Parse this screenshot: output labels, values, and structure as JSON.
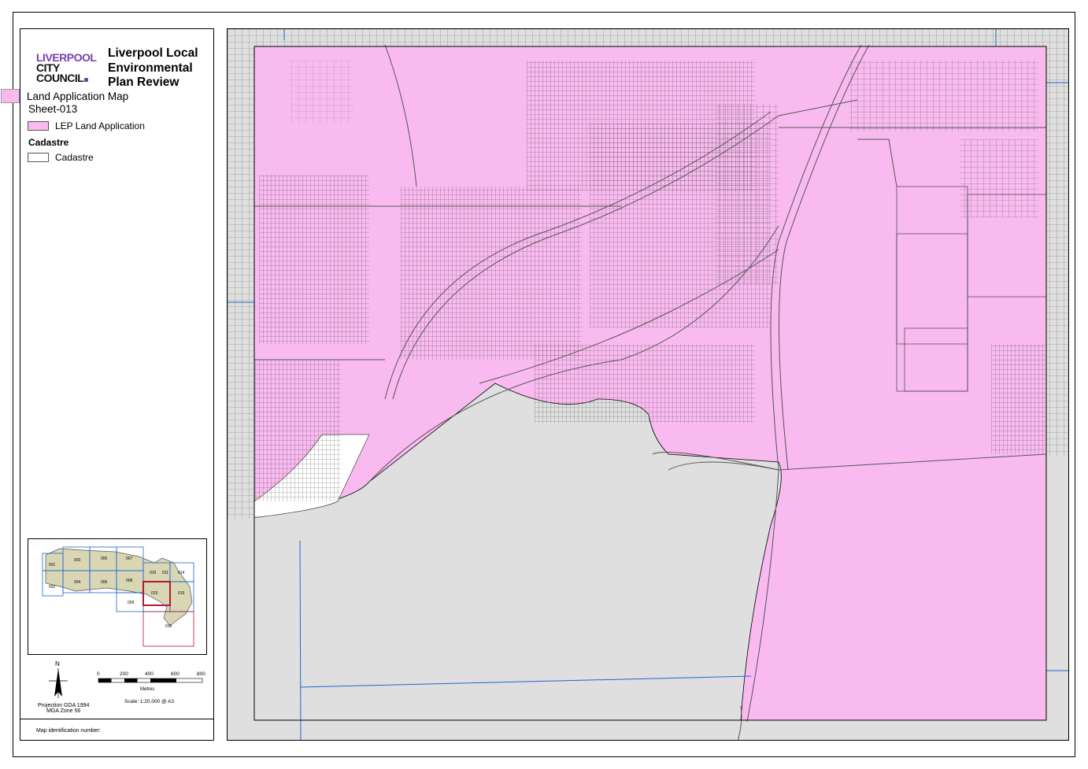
{
  "logo": {
    "line1": "LIVERPOOL",
    "line2": "CITY",
    "line3": "COUNCIL"
  },
  "title": {
    "line1": "Liverpool Local",
    "line2": "Environmental",
    "line3": "Plan Review"
  },
  "map_type": "Land Application Map",
  "sheet": "Sheet-013",
  "legend": {
    "lep_label": "LEP Land Application",
    "cadastre_heading": "Cadastre",
    "cadastre_label": "Cadastre"
  },
  "colors": {
    "lep": "#f9baf0",
    "outside": "#dfdfdf",
    "grid": "#1f66d1",
    "selected": "#b0173a",
    "lga": "#d9d6b4"
  },
  "inset": {
    "sheets": [
      "001",
      "002",
      "003",
      "004",
      "005",
      "006",
      "007",
      "008",
      "009",
      "010",
      "011",
      "013",
      "014",
      "015",
      "016"
    ],
    "current": "013"
  },
  "north": "N",
  "scale": {
    "ticks": [
      "0",
      "200",
      "400",
      "600",
      "800"
    ],
    "unit": "Metres",
    "text": "Scale: 1:20,000 @ A3"
  },
  "projection": {
    "line1": "Projection GDA 1994",
    "line2": "MGA Zone 56"
  },
  "map_id_label": "Map identification number:"
}
